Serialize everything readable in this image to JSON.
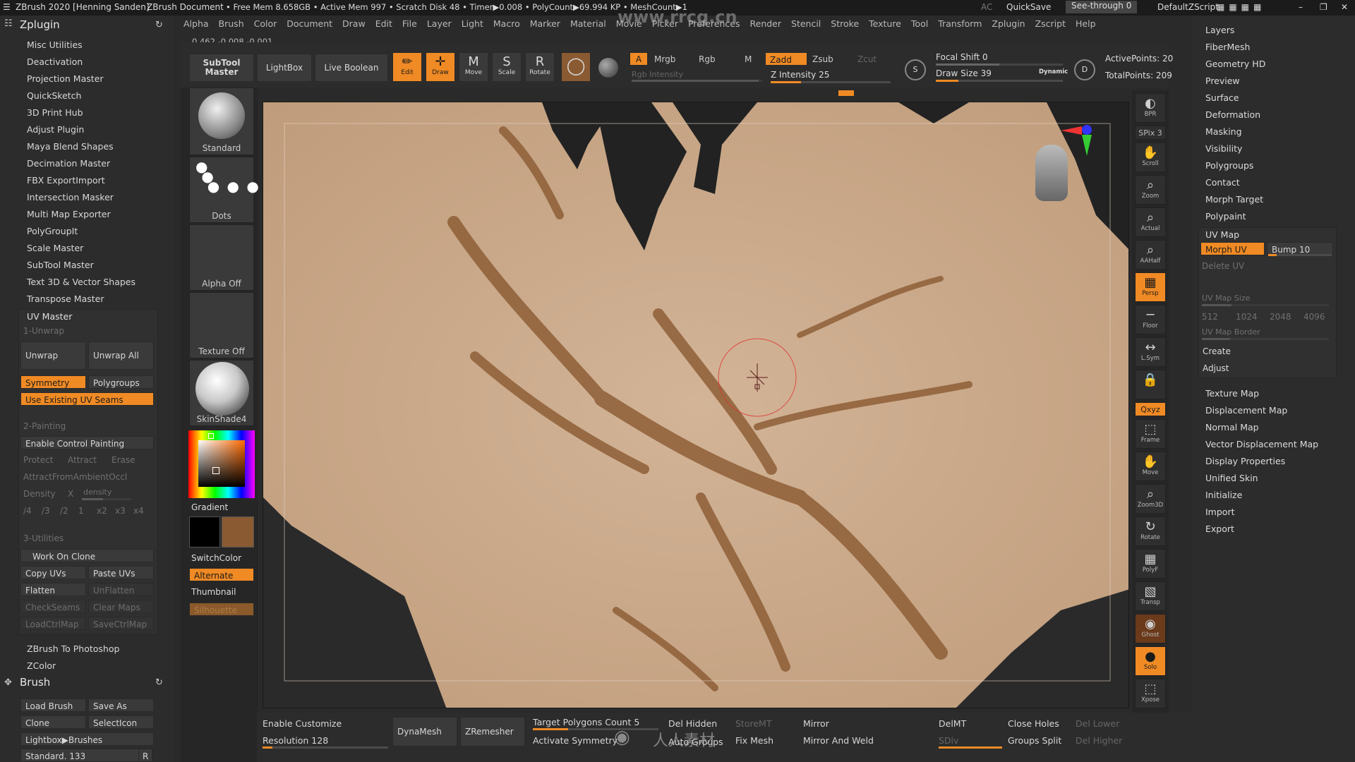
{
  "colors": {
    "accent": "#f08a24",
    "bg": "#2a2a2a",
    "clay": "#c9a98a",
    "clay_dark": "#8a5a32"
  },
  "titlebar": {
    "app": "ZBrush 2020 [Henning Sanden]",
    "doc": "ZBrush Document",
    "stats": "• Free Mem 8.658GB • Active Mem 997 • Scratch Disk 48 • Timer▶0.008 • PolyCount▶69.994 KP • MeshCount▶1",
    "ac": "AC",
    "quicksave": "QuickSave",
    "seethrough": "See-through",
    "seethrough_val": "0",
    "defaultzscript": "DefaultZScript",
    "watermark": "www.rrcg.cn"
  },
  "menus": [
    "Alpha",
    "Brush",
    "Color",
    "Document",
    "Draw",
    "Edit",
    "File",
    "Layer",
    "Light",
    "Macro",
    "Marker",
    "Material",
    "Movie",
    "Picker",
    "Preferences",
    "Render",
    "Stencil",
    "Stroke",
    "Texture",
    "Tool",
    "Transform",
    "Zplugin",
    "Zscript",
    "Help"
  ],
  "coords": "0.462,-0.008,-0.001",
  "zplugin": {
    "title": "Zplugin",
    "items": [
      "Misc Utilities",
      "Deactivation",
      "Projection Master",
      "QuickSketch",
      "3D Print Hub",
      "Adjust Plugin",
      "Maya Blend Shapes",
      "Decimation Master",
      "FBX ExportImport",
      "Intersection Masker",
      "Multi Map Exporter",
      "PolyGroupIt",
      "Scale Master",
      "SubTool Master",
      "Text 3D & Vector Shapes",
      "Transpose Master"
    ],
    "uvmaster": {
      "title": "UV Master",
      "sec1": "1-Unwrap",
      "unwrap": "Unwrap",
      "unwrap_all": "Unwrap All",
      "symmetry": "Symmetry",
      "polygroups": "Polygroups",
      "use_existing": "Use Existing UV Seams",
      "sec2": "2-Painting",
      "enable_control": "Enable Control Painting",
      "protect": "Protect",
      "attract": "Attract",
      "erase": "Erase",
      "attract_ao": "AttractFromAmbientOccl",
      "density": "Density",
      "density_x": "X",
      "density_label": "density",
      "density_vals": [
        "/4",
        "/3",
        "/2",
        "1",
        "x2",
        "x3",
        "x4"
      ],
      "sec3": "3-Utilities",
      "work_on_clone": "Work On Clone",
      "copy_uvs": "Copy UVs",
      "paste_uvs": "Paste UVs",
      "flatten": "Flatten",
      "unflatten": "UnFlatten",
      "checkseams": "CheckSeams",
      "clearmaps": "Clear Maps",
      "loadctrlmap": "LoadCtrlMap",
      "savectrlmap": "SaveCtrlMap"
    },
    "after": [
      "ZBrush To Photoshop",
      "ZColor"
    ]
  },
  "brush": {
    "title": "Brush",
    "load": "Load Brush",
    "save": "Save As",
    "clone": "Clone",
    "selecticon": "SelectIcon",
    "lightbox": "Lightbox▶Brushes",
    "current": "Standard. 133",
    "r": "R"
  },
  "shelf": {
    "subtool_master": "SubTool Master",
    "lightbox": "LightBox",
    "live_boolean": "Live Boolean",
    "tiles": [
      "Standard",
      "Dots",
      "Alpha Off",
      "Texture Off",
      "SkinShade4"
    ],
    "gradient": "Gradient",
    "switchcolor": "SwitchColor",
    "alternate": "Alternate",
    "thumbnail": "Thumbnail",
    "silhouette": "Silhouette"
  },
  "toolbar": {
    "edit": "Edit",
    "draw": "Draw",
    "move": "Move",
    "scale": "Scale",
    "rotate": "Rotate",
    "a": "A",
    "mrgb": "Mrgb",
    "rgb": "Rgb",
    "m": "M",
    "zadd": "Zadd",
    "zsub": "Zsub",
    "zcut": "Zcut",
    "rgb_intensity": "Rgb Intensity",
    "z_intensity": "Z Intensity 25",
    "z_intensity_val": 25,
    "focal_shift": "Focal Shift 0",
    "draw_size": "Draw Size 39",
    "draw_size_val": 39,
    "dynamic": "Dynamic",
    "active_points": "ActivePoints: 20",
    "total_points": "TotalPoints: 209"
  },
  "right_icons": [
    {
      "name": "bpr",
      "label": "BPR",
      "glyph": "◐"
    },
    {
      "name": "spix",
      "label": "SPix 3",
      "glyph": ""
    },
    {
      "name": "scroll",
      "label": "Scroll",
      "glyph": "✋"
    },
    {
      "name": "zoom",
      "label": "Zoom",
      "glyph": "⌕"
    },
    {
      "name": "actual",
      "label": "Actual",
      "glyph": "⌕"
    },
    {
      "name": "aahalf",
      "label": "AAHalf",
      "glyph": "⌕"
    },
    {
      "name": "persp",
      "label": "Persp",
      "glyph": "▦"
    },
    {
      "name": "floor",
      "label": "Floor",
      "glyph": "─"
    },
    {
      "name": "lsym",
      "label": "L.Sym",
      "glyph": "↔"
    },
    {
      "name": "lock",
      "label": "",
      "glyph": "🔒"
    },
    {
      "name": "xyz",
      "label": "Qxyz",
      "glyph": ""
    },
    {
      "name": "frame",
      "label": "Frame",
      "glyph": "⬚"
    },
    {
      "name": "move",
      "label": "Move",
      "glyph": "✋"
    },
    {
      "name": "zoom3d",
      "label": "Zoom3D",
      "glyph": "⌕"
    },
    {
      "name": "rotate",
      "label": "Rotate",
      "glyph": "↻"
    },
    {
      "name": "polyf",
      "label": "PolyF",
      "glyph": "▦"
    },
    {
      "name": "transp",
      "label": "Transp",
      "glyph": "▧"
    },
    {
      "name": "ghost",
      "label": "Ghost",
      "glyph": "◉"
    },
    {
      "name": "solo",
      "label": "Solo",
      "glyph": "●"
    },
    {
      "name": "xpose",
      "label": "Xpose",
      "glyph": "⬚"
    }
  ],
  "rightpanel": {
    "items_top": [
      "Layers",
      "FiberMesh",
      "Geometry HD",
      "Preview",
      "Surface",
      "Deformation",
      "Masking",
      "Visibility",
      "Polygroups",
      "Contact",
      "Morph Target",
      "Polypaint"
    ],
    "uvmap": "UV Map",
    "morph_uv": "Morph UV",
    "bump": "Bump 10",
    "delete_uv": "Delete UV",
    "uv_map_size": "UV Map Size",
    "sizes": [
      "512",
      "1024",
      "2048",
      "4096"
    ],
    "uv_map_border": "UV Map Border",
    "create": "Create",
    "adjust": "Adjust",
    "items_bottom": [
      "Texture Map",
      "Displacement Map",
      "Normal Map",
      "Vector Displacement Map",
      "Display Properties",
      "Unified Skin",
      "Initialize",
      "Import",
      "Export"
    ]
  },
  "bottombar": {
    "enable_customize": "Enable Customize",
    "resolution": "Resolution 128",
    "dynamesh": "DynaMesh",
    "zremesher": "ZRemesher",
    "target_poly": "Target Polygons Count 5",
    "activate_sym": "Activate Symmetry",
    "del_hidden": "Del Hidden",
    "auto_groups": "Auto Groups",
    "storemt": "StoreMT",
    "fix_mesh": "Fix Mesh",
    "mirror": "Mirror",
    "mirror_weld": "Mirror And Weld",
    "delmt": "DelMT",
    "sdiv": "SDiv",
    "close_holes": "Close Holes",
    "groups_split": "Groups Split",
    "del_lower": "Del Lower",
    "del_higher": "Del Higher",
    "logo_text": "人人素材"
  }
}
